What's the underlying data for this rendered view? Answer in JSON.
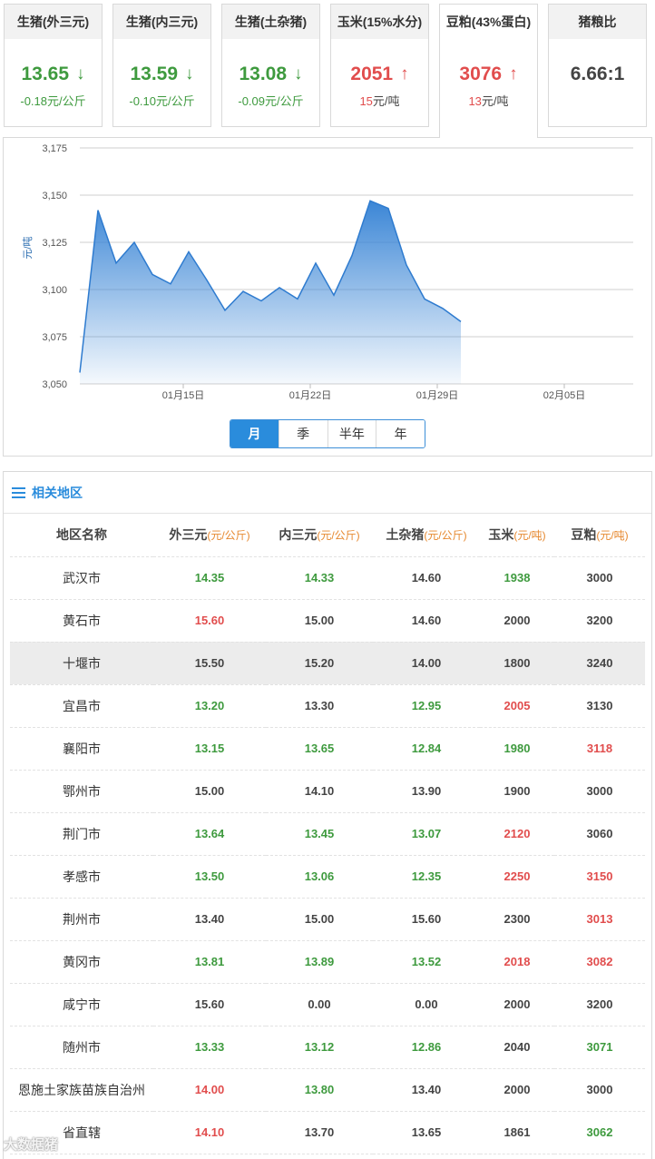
{
  "cards": [
    {
      "title": "生猪(外三元)",
      "value": "13.65",
      "arrow": "↓",
      "direction": "down",
      "change": "-0.18元/公斤"
    },
    {
      "title": "生猪(内三元)",
      "value": "13.59",
      "arrow": "↓",
      "direction": "down",
      "change": "-0.10元/公斤"
    },
    {
      "title": "生猪(土杂猪)",
      "value": "13.08",
      "arrow": "↓",
      "direction": "down",
      "change": "-0.09元/公斤"
    },
    {
      "title": "玉米(15%水分)",
      "value": "2051",
      "arrow": "↑",
      "direction": "up",
      "change_num": "15",
      "change_unit": "元/吨"
    },
    {
      "title": "豆粕(43%蛋白)",
      "value": "3076",
      "arrow": "↑",
      "direction": "up",
      "change_num": "13",
      "change_unit": "元/吨",
      "active": true
    },
    {
      "title": "猪粮比",
      "value": "6.66:1",
      "direction": "none"
    }
  ],
  "chart_data": {
    "type": "area",
    "ylabel": "元/吨",
    "ylim": [
      3050,
      3175
    ],
    "yticks": [
      "3,050",
      "3,075",
      "3,100",
      "3,125",
      "3,150",
      "3,175"
    ],
    "xticks": [
      "01月15日",
      "01月22日",
      "01月29日",
      "02月05日"
    ],
    "xtick_days": [
      15,
      22,
      29,
      36
    ],
    "xlim_days": [
      9.3,
      39.8
    ],
    "grid": true,
    "fill_color": "#3b86d6",
    "series": [
      {
        "x_days": [
          9.3,
          10.3,
          11.3,
          12.3,
          13.3,
          14.3,
          15.3,
          16.3,
          17.3,
          18.3,
          19.3,
          20.3,
          21.3,
          22.3,
          23.3,
          24.3,
          25.3,
          26.3,
          27.3,
          28.3,
          29.3,
          30.3
        ],
        "values": [
          3056,
          3142,
          3114,
          3125,
          3108,
          3103,
          3120,
          3105,
          3089,
          3099,
          3094,
          3101,
          3095,
          3114,
          3097,
          3118,
          3147,
          3143,
          3113,
          3095,
          3090,
          3083
        ]
      }
    ]
  },
  "range_buttons": [
    "月",
    "季",
    "半年",
    "年"
  ],
  "region": {
    "title": "相关地区",
    "headers": [
      {
        "label": "地区名称",
        "unit": ""
      },
      {
        "label": "外三元",
        "unit": "(元/公斤)"
      },
      {
        "label": "内三元",
        "unit": "(元/公斤)"
      },
      {
        "label": "土杂猪",
        "unit": "(元/公斤)"
      },
      {
        "label": "玉米",
        "unit": "(元/吨)"
      },
      {
        "label": "豆粕",
        "unit": "(元/吨)"
      }
    ],
    "rows": [
      {
        "name": "武汉市",
        "c": [
          [
            "14.35",
            "g"
          ],
          [
            "14.33",
            "g"
          ],
          [
            "14.60",
            "n"
          ],
          [
            "1938",
            "g"
          ],
          [
            "3000",
            "n"
          ]
        ]
      },
      {
        "name": "黄石市",
        "c": [
          [
            "15.60",
            "r"
          ],
          [
            "15.00",
            "n"
          ],
          [
            "14.60",
            "n"
          ],
          [
            "2000",
            "n"
          ],
          [
            "3200",
            "n"
          ]
        ]
      },
      {
        "name": "十堰市",
        "highlight": true,
        "c": [
          [
            "15.50",
            "n"
          ],
          [
            "15.20",
            "n"
          ],
          [
            "14.00",
            "n"
          ],
          [
            "1800",
            "n"
          ],
          [
            "3240",
            "n"
          ]
        ]
      },
      {
        "name": "宜昌市",
        "c": [
          [
            "13.20",
            "g"
          ],
          [
            "13.30",
            "n"
          ],
          [
            "12.95",
            "g"
          ],
          [
            "2005",
            "r"
          ],
          [
            "3130",
            "n"
          ]
        ]
      },
      {
        "name": "襄阳市",
        "c": [
          [
            "13.15",
            "g"
          ],
          [
            "13.65",
            "g"
          ],
          [
            "12.84",
            "g"
          ],
          [
            "1980",
            "g"
          ],
          [
            "3118",
            "r"
          ]
        ]
      },
      {
        "name": "鄂州市",
        "c": [
          [
            "15.00",
            "n"
          ],
          [
            "14.10",
            "n"
          ],
          [
            "13.90",
            "n"
          ],
          [
            "1900",
            "n"
          ],
          [
            "3000",
            "n"
          ]
        ]
      },
      {
        "name": "荆门市",
        "c": [
          [
            "13.64",
            "g"
          ],
          [
            "13.45",
            "g"
          ],
          [
            "13.07",
            "g"
          ],
          [
            "2120",
            "r"
          ],
          [
            "3060",
            "n"
          ]
        ]
      },
      {
        "name": "孝感市",
        "c": [
          [
            "13.50",
            "g"
          ],
          [
            "13.06",
            "g"
          ],
          [
            "12.35",
            "g"
          ],
          [
            "2250",
            "r"
          ],
          [
            "3150",
            "r"
          ]
        ]
      },
      {
        "name": "荆州市",
        "c": [
          [
            "13.40",
            "n"
          ],
          [
            "15.00",
            "n"
          ],
          [
            "15.60",
            "n"
          ],
          [
            "2300",
            "n"
          ],
          [
            "3013",
            "r"
          ]
        ]
      },
      {
        "name": "黄冈市",
        "c": [
          [
            "13.81",
            "g"
          ],
          [
            "13.89",
            "g"
          ],
          [
            "13.52",
            "g"
          ],
          [
            "2018",
            "r"
          ],
          [
            "3082",
            "r"
          ]
        ]
      },
      {
        "name": "咸宁市",
        "c": [
          [
            "15.60",
            "n"
          ],
          [
            "0.00",
            "n"
          ],
          [
            "0.00",
            "n"
          ],
          [
            "2000",
            "n"
          ],
          [
            "3200",
            "n"
          ]
        ]
      },
      {
        "name": "随州市",
        "c": [
          [
            "13.33",
            "g"
          ],
          [
            "13.12",
            "g"
          ],
          [
            "12.86",
            "g"
          ],
          [
            "2040",
            "n"
          ],
          [
            "3071",
            "g"
          ]
        ]
      },
      {
        "name": "恩施土家族苗族自治州",
        "c": [
          [
            "14.00",
            "r"
          ],
          [
            "13.80",
            "g"
          ],
          [
            "13.40",
            "n"
          ],
          [
            "2000",
            "n"
          ],
          [
            "3000",
            "n"
          ]
        ]
      },
      {
        "name": "省直辖",
        "c": [
          [
            "14.10",
            "r"
          ],
          [
            "13.70",
            "n"
          ],
          [
            "13.65",
            "n"
          ],
          [
            "1861",
            "n"
          ],
          [
            "3062",
            "g"
          ]
        ]
      }
    ]
  },
  "watermark": "大数据猪"
}
